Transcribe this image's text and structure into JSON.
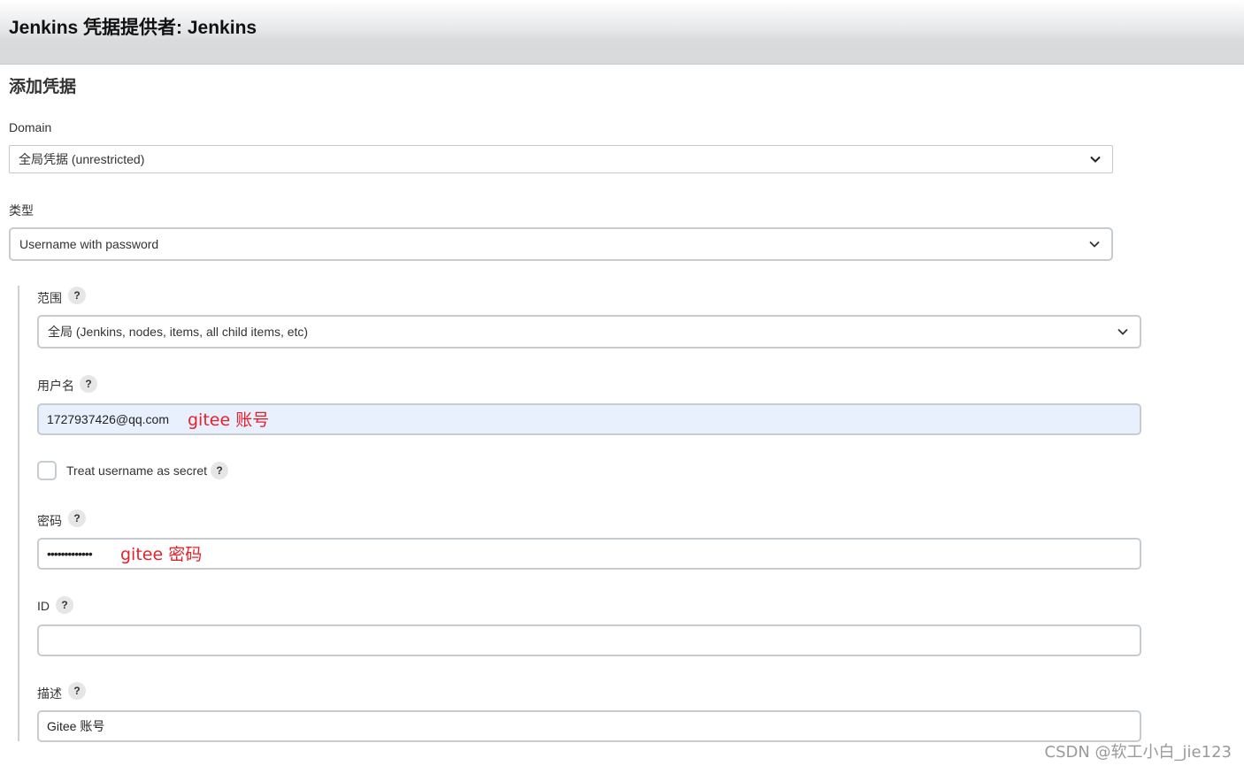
{
  "header": {
    "title": "Jenkins 凭据提供者: Jenkins"
  },
  "section_title": "添加凭据",
  "domain": {
    "label": "Domain",
    "value": "全局凭据 (unrestricted)"
  },
  "kind": {
    "label": "类型",
    "value": "Username with password"
  },
  "scope": {
    "label": "范围",
    "help": "?",
    "value": "全局 (Jenkins, nodes, items, all child items, etc)"
  },
  "username": {
    "label": "用户名",
    "help": "?",
    "value": "1727937426@qq.com",
    "annotation": "gitee 账号"
  },
  "treat_secret": {
    "label": "Treat username as secret",
    "help": "?",
    "checked": false
  },
  "password": {
    "label": "密码",
    "help": "?",
    "value": "•••••••••••••",
    "annotation": "gitee 密码"
  },
  "id": {
    "label": "ID",
    "help": "?",
    "value": ""
  },
  "description": {
    "label": "描述",
    "help": "?",
    "value": "Gitee 账号"
  },
  "watermark": "CSDN @软工小白_jie123",
  "colors": {
    "annotation": "#e8202a",
    "autofill_bg": "#e8f0fe",
    "header_bg": "#dadbdd"
  },
  "icons": [
    "chevron-down-icon",
    "help-icon"
  ]
}
